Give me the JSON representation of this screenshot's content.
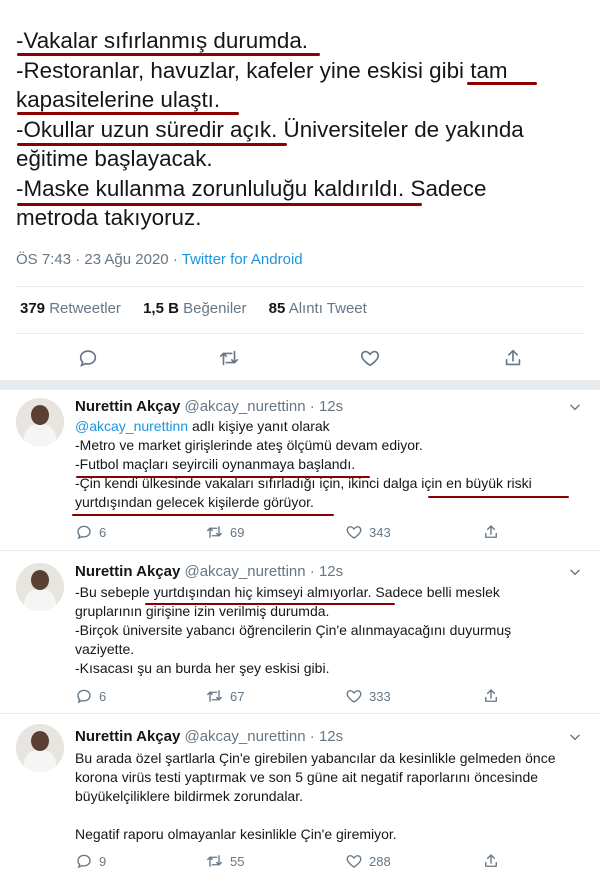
{
  "main_tweet": {
    "lines": [
      "-Vakalar sıfırlanmış durumda.",
      "-Restoranlar, havuzlar, kafeler yine eskisi gibi tam",
      "kapasitelerine ulaştı.",
      "-Okullar uzun süredir açık. Üniversiteler de yakında",
      "eğitime başlayacak.",
      "-Maske kullanma zorunluluğu kaldırıldı. Sadece",
      "metroda takıyoruz."
    ],
    "time": "ÖS 7:43",
    "date": "23 Ağu 2020",
    "separator": "·",
    "source": "Twitter for Android",
    "stats": {
      "retweets_count": "379",
      "retweets_label": "Retweetler",
      "likes_count": "1,5 B",
      "likes_label": "Beğeniler",
      "quotes_count": "85",
      "quotes_label": "Alıntı Tweet"
    }
  },
  "replies": [
    {
      "name": "Nurettin Akçay",
      "handle": "@akcay_nurettinn",
      "time": "12s",
      "replying_mention": "@akcay_nurettinn",
      "replying_suffix": " adlı kişiye yanıt olarak",
      "lines": [
        "-Metro ve market girişlerinde ateş ölçümü devam ediyor.",
        "-Futbol maçları seyircili oynanmaya başlandı.",
        "-Çin kendi ülkesinde vakaları sıfırladığı için, ikinci dalga için en büyük riski",
        "yurtdışından gelecek kişilerde görüyor."
      ],
      "replies_count": "6",
      "retweets_count": "69",
      "likes_count": "343"
    },
    {
      "name": "Nurettin Akçay",
      "handle": "@akcay_nurettinn",
      "time": "12s",
      "lines": [
        "-Bu sebeple yurtdışından hiç kimseyi almıyorlar. Sadece belli meslek",
        "gruplarının girişine izin verilmiş durumda.",
        "-Birçok üniversite yabancı öğrencilerin Çin'e alınmayacağını duyurmuş",
        "vaziyette.",
        "-Kısacası şu an burda her şey eskisi gibi."
      ],
      "replies_count": "6",
      "retweets_count": "67",
      "likes_count": "333"
    },
    {
      "name": "Nurettin Akçay",
      "handle": "@akcay_nurettinn",
      "time": "12s",
      "lines": [
        "Bu arada özel şartlarla Çin'e girebilen yabancılar da kesinlikle gelmeden önce",
        "korona virüs testi yaptırmak ve son 5 güne ait negatif raporlarını öncesinde",
        "büyükelçiliklere bildirmek zorundalar.",
        "",
        "Negatif raporu olmayanlar kesinlikle Çin'e giremiyor."
      ],
      "replies_count": "9",
      "retweets_count": "55",
      "likes_count": "288"
    }
  ],
  "colors": {
    "text": "#14171a",
    "secondary": "#657786",
    "link": "#1b95e0",
    "annotation_underline": "#8b0000",
    "divider": "#e6ecf0"
  }
}
